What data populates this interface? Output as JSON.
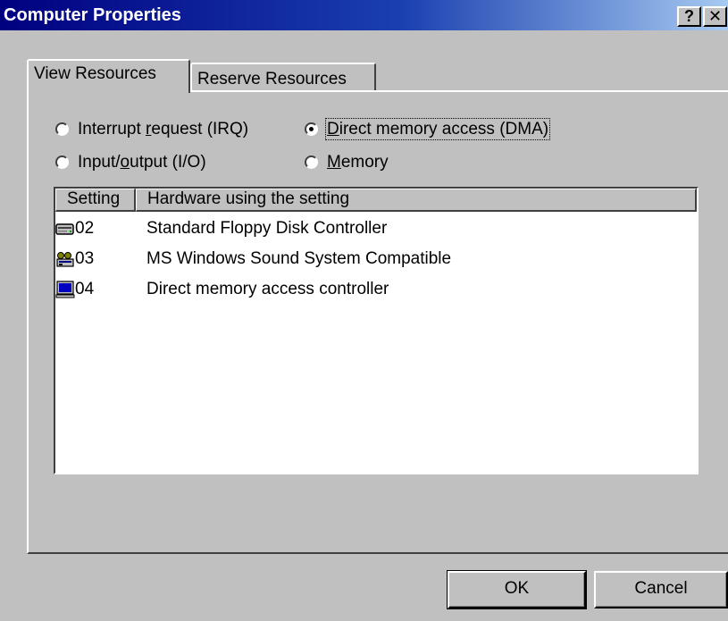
{
  "window": {
    "title": "Computer Properties",
    "help_label": "?",
    "close_label": "✕"
  },
  "tabs": [
    {
      "label": "View Resources",
      "selected": true
    },
    {
      "label": "Reserve Resources",
      "selected": false
    }
  ],
  "resource_types": [
    {
      "pre": "Interrupt ",
      "key": "r",
      "post": "equest (IRQ)",
      "selected": false
    },
    {
      "pre": "",
      "key": "D",
      "post": "irect memory access (DMA)",
      "selected": true
    },
    {
      "pre": "Input/",
      "key": "o",
      "post": "utput (I/O)",
      "selected": false
    },
    {
      "pre": "",
      "key": "M",
      "post": "emory",
      "selected": false
    }
  ],
  "list": {
    "columns": [
      "Setting",
      "Hardware using the setting"
    ],
    "rows": [
      {
        "icon": "floppy-drive-icon",
        "setting": "02",
        "hardware": "Standard Floppy Disk Controller"
      },
      {
        "icon": "sound-device-icon",
        "setting": "03",
        "hardware": "MS Windows Sound System Compatible"
      },
      {
        "icon": "computer-icon",
        "setting": "04",
        "hardware": "Direct memory access controller"
      }
    ]
  },
  "buttons": {
    "ok_label": "OK",
    "cancel_label": "Cancel"
  },
  "colors": {
    "titlebar_start": "#000080",
    "titlebar_end": "#a6caf0",
    "face": "#c0c0c0"
  }
}
